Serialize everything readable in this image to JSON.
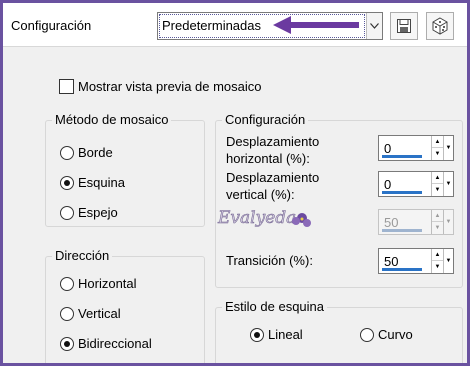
{
  "header": {
    "config_label": "Configuración",
    "preset_value": "Predeterminadas"
  },
  "preview_checkbox": {
    "label": "Mostrar vista previa de mosaico",
    "checked": false
  },
  "tile_method": {
    "title": "Método de mosaico",
    "options": [
      "Borde",
      "Esquina",
      "Espejo"
    ],
    "selected": "Esquina"
  },
  "direction": {
    "title": "Dirección",
    "options": [
      "Horizontal",
      "Vertical",
      "Bidireccional"
    ],
    "selected": "Bidireccional"
  },
  "settings": {
    "title": "Configuración",
    "h_offset_label_1": "Desplazamiento",
    "h_offset_label_2": "horizontal (%):",
    "h_offset_value": "0",
    "v_offset_label_1": "Desplazamiento",
    "v_offset_label_2": "vertical (%):",
    "v_offset_value": "0",
    "disabled_value": "50",
    "transition_label": "Transición (%):",
    "transition_value": "50"
  },
  "corner_style": {
    "title": "Estilo de esquina",
    "options": [
      "Lineal",
      "Curvo"
    ],
    "selected": "Lineal"
  },
  "watermark_text": "Evalyeda",
  "colors": {
    "frame": "#6a52a0",
    "annotation_arrow": "#6b3aa0",
    "spin_bar": "#2a73c6"
  },
  "icons": [
    "save-icon",
    "randomize-dice-icon",
    "dropdown-arrow-icon"
  ]
}
